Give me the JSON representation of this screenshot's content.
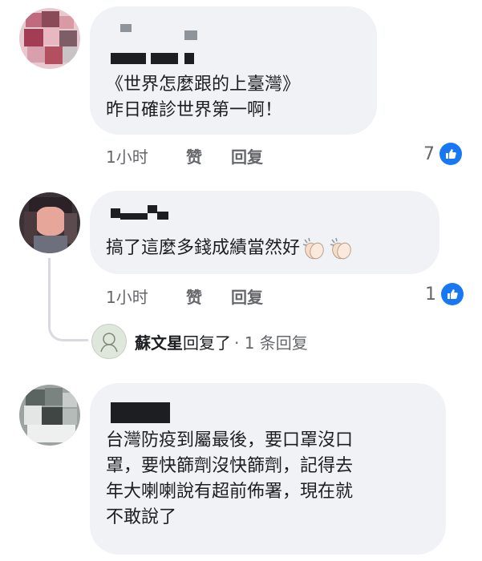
{
  "comments": [
    {
      "text_lines": [
        "《世界怎麼跟的上臺灣》",
        "昨日確診世界第一啊！"
      ],
      "time": "1小时",
      "like_label": "赞",
      "reply_label": "回复",
      "like_count": "7"
    },
    {
      "text_lines": [
        "搞了這麼多錢成績當然好"
      ],
      "emoji": [
        "clapping-hands",
        "clapping-hands"
      ],
      "time": "1小时",
      "like_label": "赞",
      "reply_label": "回复",
      "like_count": "1",
      "replies": {
        "author": "蘇文星",
        "action": "回复了",
        "count_text": "· 1 条回复"
      }
    },
    {
      "text_lines": [
        "台灣防疫到屬最後，要口罩沒口",
        "罩，要快篩劑沒快篩劑，記得去",
        "年大喇喇說有超前佈署，現在就",
        "不敢說了"
      ]
    }
  ],
  "colors": {
    "bubble": "#f0f2f5",
    "like_blue": "#1877f2",
    "meta_text": "#65676b"
  }
}
